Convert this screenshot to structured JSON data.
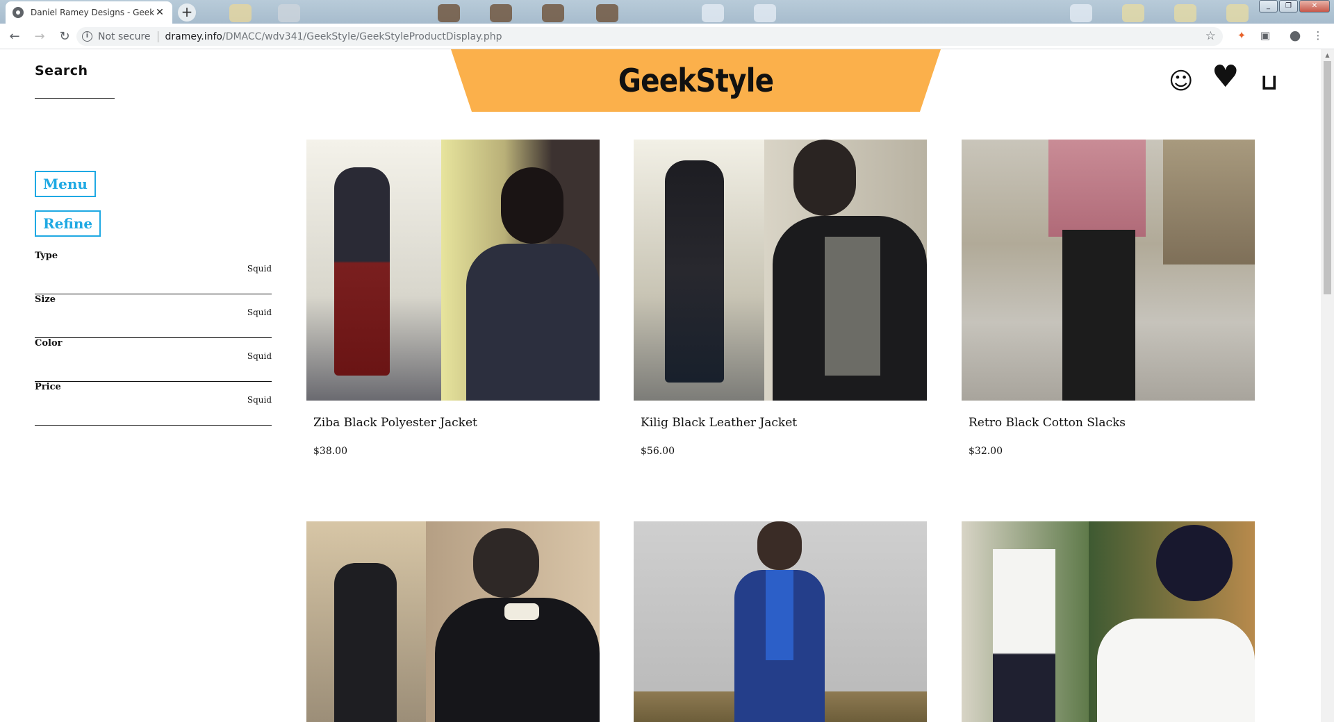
{
  "browser": {
    "tab_title": "Daniel Ramey Designs - GeekSty",
    "tab_close": "✕",
    "new_tab": "+",
    "security_label": "Not secure",
    "url_host": "dramey.info",
    "url_path": "/DMACC/wdv341/GeekStyle/GeekStyleProductDisplay.php"
  },
  "header": {
    "search_label": "Search",
    "brand": "GeekStyle",
    "brand_color": "#fbb04b",
    "account_icon": "☺",
    "wishlist_icon": "♥",
    "cart_icon": "⊔"
  },
  "sidebar": {
    "menu_label": "Menu",
    "refine_label": "Refine",
    "accent_color": "#1fa9e3",
    "filters": [
      {
        "name": "Type",
        "value": "Squid"
      },
      {
        "name": "Size",
        "value": "Squid"
      },
      {
        "name": "Color",
        "value": "Squid"
      },
      {
        "name": "Price",
        "value": "Squid"
      }
    ]
  },
  "products": [
    {
      "name": "Ziba Black Polyester Jacket",
      "price": "$38.00"
    },
    {
      "name": "Kilig Black Leather Jacket",
      "price": "$56.00"
    },
    {
      "name": "Retro Black Cotton Slacks",
      "price": "$32.00"
    },
    {
      "name": "",
      "price": ""
    },
    {
      "name": "",
      "price": ""
    },
    {
      "name": "",
      "price": ""
    }
  ]
}
